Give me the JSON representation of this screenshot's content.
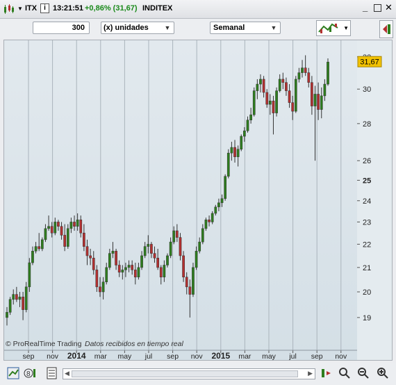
{
  "window": {
    "symbol": "ITX",
    "time": "13:21:51",
    "change": "+0,86% (31,67)",
    "name": "INDITEX",
    "change_color": "#1a8a1a"
  },
  "toolbar": {
    "quantity_value": "300",
    "units_label": "(x) unidades",
    "period_label": "Semanal"
  },
  "chart_data": {
    "type": "candlestick",
    "title": "",
    "price_axis_ticks": [
      "19",
      "20",
      "21",
      "22",
      "23",
      "24",
      "25",
      "26",
      "28",
      "30",
      "32"
    ],
    "price_axis_scale": "log",
    "ylim": [
      18.4,
      32.8
    ],
    "time_axis_labels": [
      "sep",
      "nov",
      "2014",
      "mar",
      "may",
      "jul",
      "sep",
      "nov",
      "2015",
      "mar",
      "may",
      "jul",
      "sep",
      "nov"
    ],
    "last_price": "31,67",
    "last_price_color": "#f2c200",
    "grid": "vertical",
    "up_color": "#2e7d1e",
    "down_color": "#b33030",
    "candles": [
      [
        19.0,
        19.4,
        18.7,
        19.2
      ],
      [
        19.2,
        19.8,
        19.1,
        19.7
      ],
      [
        19.7,
        20.1,
        19.5,
        19.9
      ],
      [
        19.9,
        20.2,
        19.6,
        19.7
      ],
      [
        19.7,
        20.0,
        19.4,
        19.8
      ],
      [
        19.8,
        20.0,
        18.9,
        19.3
      ],
      [
        19.3,
        20.4,
        19.2,
        20.2
      ],
      [
        20.2,
        21.4,
        20.0,
        21.2
      ],
      [
        21.2,
        21.9,
        21.1,
        21.7
      ],
      [
        21.7,
        22.1,
        21.6,
        21.9
      ],
      [
        21.9,
        22.5,
        21.7,
        21.8
      ],
      [
        21.8,
        22.3,
        21.7,
        22.2
      ],
      [
        22.2,
        22.9,
        22.1,
        22.7
      ],
      [
        22.7,
        23.3,
        22.6,
        22.8
      ],
      [
        22.8,
        23.0,
        22.3,
        22.5
      ],
      [
        22.5,
        23.2,
        22.4,
        23.0
      ],
      [
        23.0,
        23.1,
        22.6,
        22.8
      ],
      [
        22.8,
        23.0,
        22.2,
        22.4
      ],
      [
        22.4,
        22.9,
        21.7,
        21.9
      ],
      [
        21.9,
        22.9,
        21.8,
        22.7
      ],
      [
        22.7,
        23.2,
        22.5,
        23.0
      ],
      [
        23.0,
        23.3,
        22.6,
        22.8
      ],
      [
        22.8,
        23.4,
        22.6,
        23.1
      ],
      [
        23.1,
        23.3,
        22.3,
        22.5
      ],
      [
        22.5,
        22.9,
        21.7,
        21.9
      ],
      [
        21.9,
        22.2,
        21.1,
        21.5
      ],
      [
        21.5,
        21.8,
        21.1,
        21.4
      ],
      [
        21.4,
        21.7,
        20.7,
        20.9
      ],
      [
        20.9,
        21.1,
        20.0,
        20.2
      ],
      [
        20.2,
        20.6,
        19.8,
        20.0
      ],
      [
        20.0,
        20.6,
        19.7,
        20.4
      ],
      [
        20.4,
        21.2,
        20.3,
        21.0
      ],
      [
        21.0,
        21.8,
        20.9,
        21.6
      ],
      [
        21.6,
        22.1,
        21.4,
        21.7
      ],
      [
        21.7,
        21.8,
        20.9,
        21.1
      ],
      [
        21.1,
        21.3,
        20.6,
        20.8
      ],
      [
        20.8,
        21.1,
        20.5,
        20.9
      ],
      [
        20.9,
        21.2,
        20.6,
        21.0
      ],
      [
        21.0,
        21.3,
        20.8,
        21.1
      ],
      [
        21.1,
        21.3,
        20.7,
        20.9
      ],
      [
        20.9,
        21.2,
        20.3,
        20.6
      ],
      [
        20.6,
        21.2,
        20.5,
        21.0
      ],
      [
        21.0,
        21.7,
        20.9,
        21.5
      ],
      [
        21.5,
        22.1,
        21.4,
        21.9
      ],
      [
        21.9,
        22.4,
        21.6,
        22.0
      ],
      [
        22.0,
        22.1,
        21.4,
        21.6
      ],
      [
        21.6,
        21.9,
        21.2,
        21.4
      ],
      [
        21.4,
        21.8,
        20.9,
        21.0
      ],
      [
        21.0,
        21.1,
        20.3,
        20.6
      ],
      [
        20.6,
        21.3,
        20.4,
        21.1
      ],
      [
        21.1,
        21.6,
        21.0,
        21.5
      ],
      [
        21.5,
        22.3,
        21.4,
        22.1
      ],
      [
        22.1,
        22.8,
        22.0,
        22.6
      ],
      [
        22.6,
        22.9,
        22.1,
        22.3
      ],
      [
        22.3,
        22.5,
        21.3,
        21.5
      ],
      [
        21.5,
        21.7,
        20.4,
        20.6
      ],
      [
        20.6,
        20.8,
        19.9,
        20.2
      ],
      [
        20.2,
        20.5,
        19.0,
        19.9
      ],
      [
        19.9,
        21.2,
        19.8,
        21.0
      ],
      [
        21.0,
        21.9,
        20.9,
        21.7
      ],
      [
        21.7,
        22.3,
        21.6,
        22.1
      ],
      [
        22.1,
        22.9,
        22.0,
        22.7
      ],
      [
        22.7,
        23.2,
        22.6,
        23.1
      ],
      [
        23.1,
        23.3,
        22.8,
        23.0
      ],
      [
        23.0,
        23.5,
        22.9,
        23.4
      ],
      [
        23.4,
        23.8,
        23.3,
        23.7
      ],
      [
        23.7,
        24.1,
        23.5,
        23.9
      ],
      [
        23.9,
        24.3,
        23.7,
        24.1
      ],
      [
        24.1,
        25.3,
        24.0,
        25.2
      ],
      [
        25.2,
        26.6,
        25.1,
        26.4
      ],
      [
        26.4,
        27.0,
        26.0,
        26.7
      ],
      [
        26.7,
        27.1,
        25.9,
        26.2
      ],
      [
        26.2,
        26.8,
        25.7,
        26.6
      ],
      [
        26.6,
        27.4,
        26.5,
        27.3
      ],
      [
        27.3,
        27.8,
        27.0,
        27.6
      ],
      [
        27.6,
        28.4,
        27.5,
        28.2
      ],
      [
        28.2,
        28.9,
        28.0,
        28.5
      ],
      [
        28.5,
        30.1,
        28.4,
        29.9
      ],
      [
        29.9,
        30.6,
        29.4,
        30.3
      ],
      [
        30.3,
        30.9,
        29.8,
        30.6
      ],
      [
        30.6,
        30.8,
        29.5,
        29.8
      ],
      [
        29.8,
        30.0,
        28.9,
        29.1
      ],
      [
        29.1,
        29.7,
        28.5,
        29.3
      ],
      [
        29.3,
        29.6,
        27.4,
        28.6
      ],
      [
        28.6,
        30.1,
        28.4,
        29.9
      ],
      [
        29.9,
        30.9,
        29.8,
        30.6
      ],
      [
        30.6,
        31.0,
        30.0,
        30.4
      ],
      [
        30.4,
        30.7,
        29.6,
        29.9
      ],
      [
        29.9,
        30.3,
        28.9,
        29.2
      ],
      [
        29.2,
        29.6,
        28.2,
        28.7
      ],
      [
        28.7,
        30.8,
        28.6,
        30.6
      ],
      [
        30.6,
        31.3,
        30.4,
        31.0
      ],
      [
        31.0,
        31.8,
        30.7,
        31.3
      ],
      [
        31.3,
        32.1,
        30.8,
        31.0
      ],
      [
        31.0,
        31.3,
        30.1,
        30.4
      ],
      [
        30.4,
        30.8,
        28.5,
        29.0
      ],
      [
        29.0,
        30.2,
        26.0,
        29.7
      ],
      [
        29.7,
        30.4,
        28.2,
        28.8
      ],
      [
        28.8,
        30.1,
        28.3,
        29.6
      ],
      [
        29.6,
        30.6,
        29.3,
        30.3
      ],
      [
        30.3,
        31.9,
        30.2,
        31.67
      ]
    ]
  },
  "watermark": {
    "brand": "© ProRealTime Trading",
    "status": "Datos recibidos en tiempo real"
  }
}
